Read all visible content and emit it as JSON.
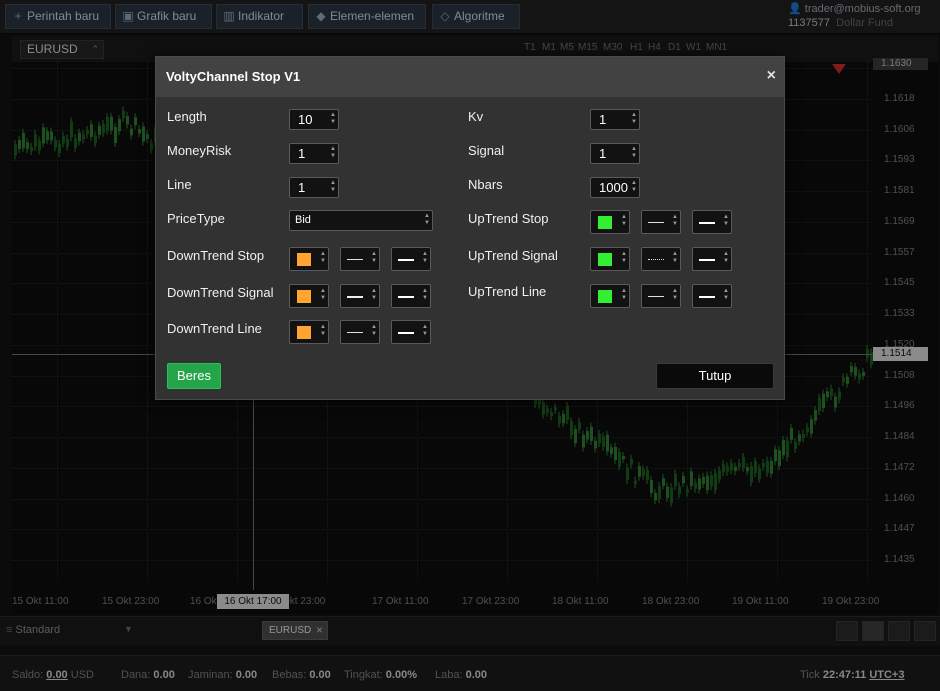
{
  "toolbar": {
    "new_order": "Perintah baru",
    "new_chart": "Grafik baru",
    "indicators": "Indikator",
    "elements": "Elemen-elemen",
    "algorithms": "Algoritme"
  },
  "account": {
    "email": "trader@mobius-soft.org",
    "number": "1137577",
    "fund_label": "Dollar Fund"
  },
  "chart": {
    "symbol": "EURUSD",
    "timeframes": [
      "T1",
      "M1",
      "M5",
      "M15",
      "M30",
      "H1",
      "H4",
      "D1",
      "W1",
      "MN1"
    ],
    "price_labels": [
      "1.1630",
      "1.1618",
      "1.1606",
      "1.1593",
      "1.1581",
      "1.1569",
      "1.1557",
      "1.1545",
      "1.1533",
      "1.1520",
      "1.1508",
      "1.1496",
      "1.1484",
      "1.1472",
      "1.1460",
      "1.1447",
      "1.1435"
    ],
    "current_price": "1.1514",
    "date_labels": [
      "15 Okt 11:00",
      "15 Okt 23:00",
      "16 Okt 17:00",
      "Okt 23:00",
      "17 Okt 11:00",
      "17 Okt 23:00",
      "18 Okt 11:00",
      "18 Okt 23:00",
      "19 Okt 11:00",
      "19 Okt 23:00"
    ],
    "crosshair_date": "16 Okt 17:00",
    "bull_color": "#2e7d32",
    "bear_color": "#1b5e20"
  },
  "dialog": {
    "title": "VoltyChannel Stop V1",
    "close_glyph": "×",
    "length_label": "Length",
    "length_value": "10",
    "moneyrisk_label": "MoneyRisk",
    "moneyrisk_value": "1",
    "line_label": "Line",
    "line_value": "1",
    "pricetype_label": "PriceType",
    "pricetype_value": "Bid",
    "downtrend_stop_label": "DownTrend Stop",
    "downtrend_signal_label": "DownTrend Signal",
    "downtrend_line_label": "DownTrend Line",
    "kv_label": "Kv",
    "kv_value": "1",
    "signal_label": "Signal",
    "signal_value": "1",
    "nbars_label": "Nbars",
    "nbars_value": "1000",
    "uptrend_stop_label": "UpTrend Stop",
    "uptrend_signal_label": "UpTrend Signal",
    "uptrend_line_label": "UpTrend Line",
    "down_color": "#ffa530",
    "up_color": "#33ee33",
    "ok_label": "Beres",
    "close_label": "Tutup"
  },
  "bottom": {
    "layout_select": "Standard",
    "tab_symbol": "EURUSD",
    "tab_close": "×"
  },
  "status": {
    "saldo_label": "Saldo:",
    "saldo_value": "0.00",
    "saldo_currency": "USD",
    "dana_label": "Dana:",
    "dana_value": "0.00",
    "jaminan_label": "Jaminan:",
    "jaminan_value": "0.00",
    "bebas_label": "Bebas:",
    "bebas_value": "0.00",
    "tingkat_label": "Tingkat:",
    "tingkat_value": "0.00%",
    "laba_label": "Laba:",
    "laba_value": "0.00",
    "tick_label": "Tick",
    "time_value": "22:47:11",
    "timezone": "UTC+3"
  }
}
